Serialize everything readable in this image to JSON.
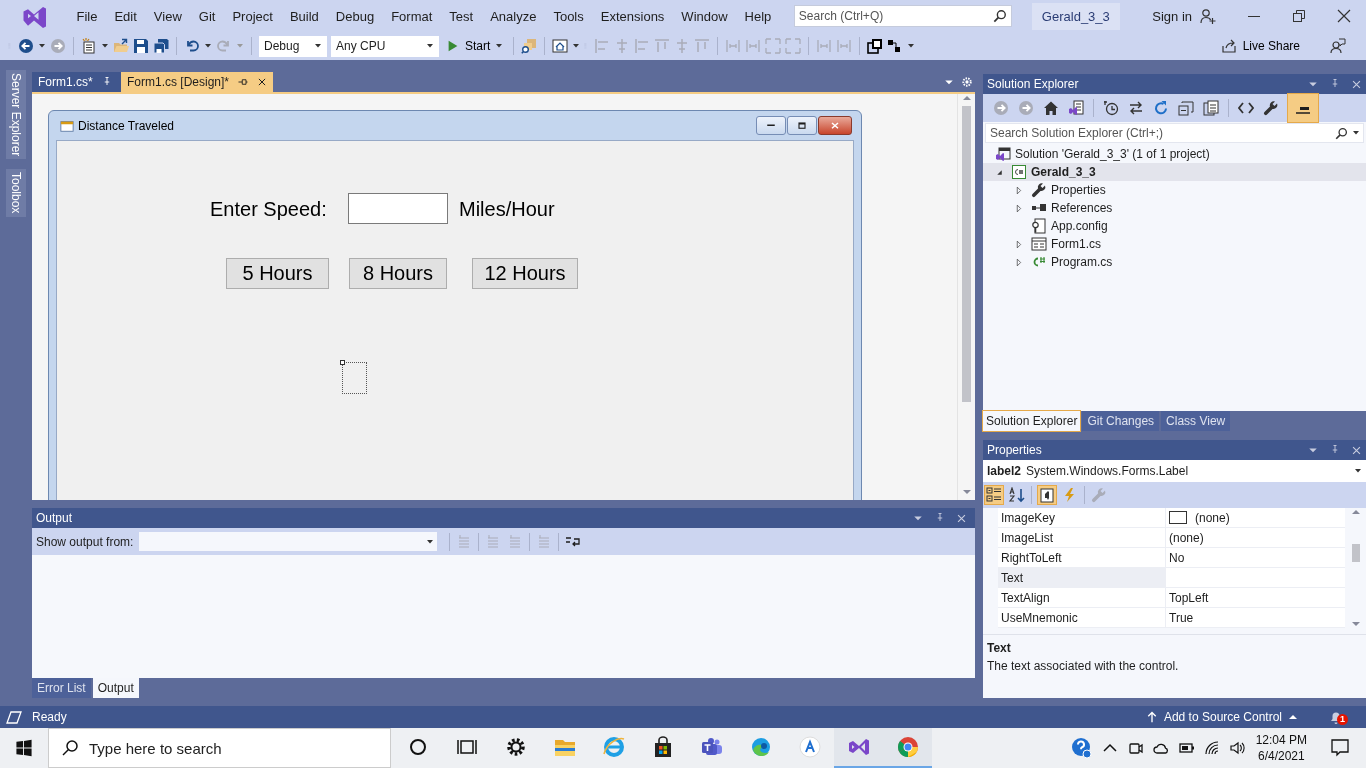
{
  "window": {
    "solution": "Gerald_3_3",
    "sign_in": "Sign in"
  },
  "menu": [
    "File",
    "Edit",
    "View",
    "Git",
    "Project",
    "Build",
    "Debug",
    "Format",
    "Test",
    "Analyze",
    "Tools",
    "Extensions",
    "Window",
    "Help"
  ],
  "search": {
    "placeholder": "Search (Ctrl+Q)"
  },
  "toolbar": {
    "configuration": "Debug",
    "platform": "Any CPU",
    "start": "Start",
    "live_share": "Live Share"
  },
  "side_tabs": [
    "Server Explorer",
    "Toolbox"
  ],
  "document_tabs": [
    {
      "label": "Form1.cs*",
      "selected": false
    },
    {
      "label": "Form1.cs [Design]*",
      "selected": true
    }
  ],
  "designer_form": {
    "title": "Distance Traveled",
    "speed_label": "Enter Speed:",
    "unit_label": "Miles/Hour",
    "buttons": [
      "5 Hours",
      "8 Hours",
      "12 Hours"
    ]
  },
  "output": {
    "title": "Output",
    "show_from": "Show output from:",
    "tabs": [
      {
        "label": "Error List",
        "selected": false
      },
      {
        "label": "Output",
        "selected": true
      }
    ]
  },
  "solution_explorer": {
    "title": "Solution Explorer",
    "search_placeholder": "Search Solution Explorer (Ctrl+;)",
    "tree": [
      {
        "label": "Solution 'Gerald_3_3' (1 of 1 project)",
        "kind": "solution",
        "selected": false,
        "children": [
          {
            "label": "Gerald_3_3",
            "kind": "project",
            "expanded": true,
            "selected": true,
            "children": [
              {
                "label": "Properties",
                "kind": "properties",
                "expanded": false,
                "selected": false
              },
              {
                "label": "References",
                "kind": "references",
                "expanded": false,
                "selected": false
              },
              {
                "label": "App.config",
                "kind": "config",
                "selected": false
              },
              {
                "label": "Form1.cs",
                "kind": "form",
                "expanded": false,
                "selected": false
              },
              {
                "label": "Program.cs",
                "kind": "csharp",
                "expanded": false,
                "selected": false
              }
            ]
          }
        ]
      }
    ],
    "tabs": [
      {
        "label": "Solution Explorer",
        "selected": true
      },
      {
        "label": "Git Changes",
        "selected": false
      },
      {
        "label": "Class View",
        "selected": false
      }
    ]
  },
  "properties": {
    "title": "Properties",
    "object": "label2",
    "type": "System.Windows.Forms.Label",
    "rows": [
      {
        "name": "ImageKey",
        "value": "(none)",
        "kind": "swatch",
        "selected": false
      },
      {
        "name": "ImageList",
        "value": "(none)",
        "kind": "text",
        "selected": false
      },
      {
        "name": "RightToLeft",
        "value": "No",
        "kind": "text",
        "selected": false
      },
      {
        "name": "Text",
        "kind": "text",
        "selected": true
      },
      {
        "name": "TextAlign",
        "value": "TopLeft",
        "kind": "text",
        "selected": false
      },
      {
        "name": "UseMnemonic",
        "value": "True",
        "kind": "text",
        "selected": false
      }
    ],
    "description": {
      "title": "Text",
      "text": "The text associated with the control."
    }
  },
  "status_bar": {
    "state": "Ready",
    "source_control": "Add to Source Control",
    "notifications": "1"
  },
  "taskbar": {
    "search_placeholder": "Type here to search",
    "apps": [
      {
        "kind": "cortana",
        "open": false
      },
      {
        "kind": "task-view",
        "open": false
      },
      {
        "kind": "settings",
        "open": false
      },
      {
        "kind": "file-explorer",
        "open": false
      },
      {
        "kind": "internet-explorer",
        "open": false
      },
      {
        "kind": "store",
        "open": false
      },
      {
        "kind": "teams",
        "open": false
      },
      {
        "kind": "edge",
        "open": false
      },
      {
        "kind": "app",
        "open": false
      },
      {
        "kind": "visual-studio",
        "open": true
      },
      {
        "kind": "browser",
        "open": true
      }
    ],
    "time": "12:04 PM",
    "date": "6/4/2021"
  }
}
